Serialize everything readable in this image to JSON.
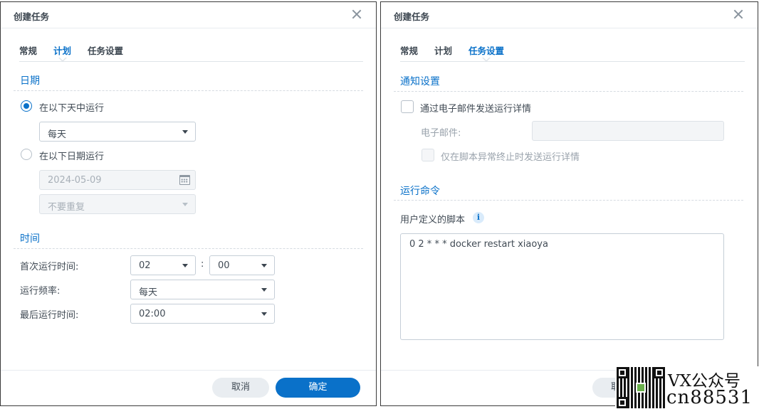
{
  "left_dialog": {
    "title": "创建任务",
    "tabs": [
      "常规",
      "计划",
      "任务设置"
    ],
    "active_tab": 1,
    "date_section": {
      "title": "日期",
      "option_daily": {
        "label": "在以下天中运行",
        "checked": true
      },
      "days_select": "每天",
      "option_date": {
        "label": "在以下日期运行",
        "checked": false
      },
      "date_input": "2024-05-09",
      "repeat_select": "不要重复"
    },
    "time_section": {
      "title": "时间",
      "first_run_label": "首次运行时间:",
      "hour_select": "02",
      "colon": ":",
      "minute_select": "00",
      "frequency_label": "运行频率:",
      "frequency_select": "每天",
      "last_run_label": "最后运行时间:",
      "last_run_select": "02:00"
    },
    "cancel_label": "取消",
    "ok_label": "确定"
  },
  "right_dialog": {
    "title": "创建任务",
    "tabs": [
      "常规",
      "计划",
      "任务设置"
    ],
    "active_tab": 2,
    "notify_section": {
      "title": "通知设置",
      "send_email_label": "通过电子邮件发送运行详情",
      "email_label": "电子邮件:",
      "email_value": "",
      "abnormal_only_label": "仅在脚本异常终止时发送运行详情"
    },
    "command_section": {
      "title": "运行命令",
      "script_label": "用户定义的脚本",
      "info_glyph": "i",
      "script_content": "0 2 * * * docker restart xiaoya"
    },
    "cancel_label_partial": "取"
  },
  "watermark": {
    "line1": "VX公众号",
    "line2": "cn88531"
  },
  "colors": {
    "accent": "#0a71c9",
    "text": "#414b55",
    "muted": "#a8b0b8",
    "border": "#c5ced7"
  }
}
